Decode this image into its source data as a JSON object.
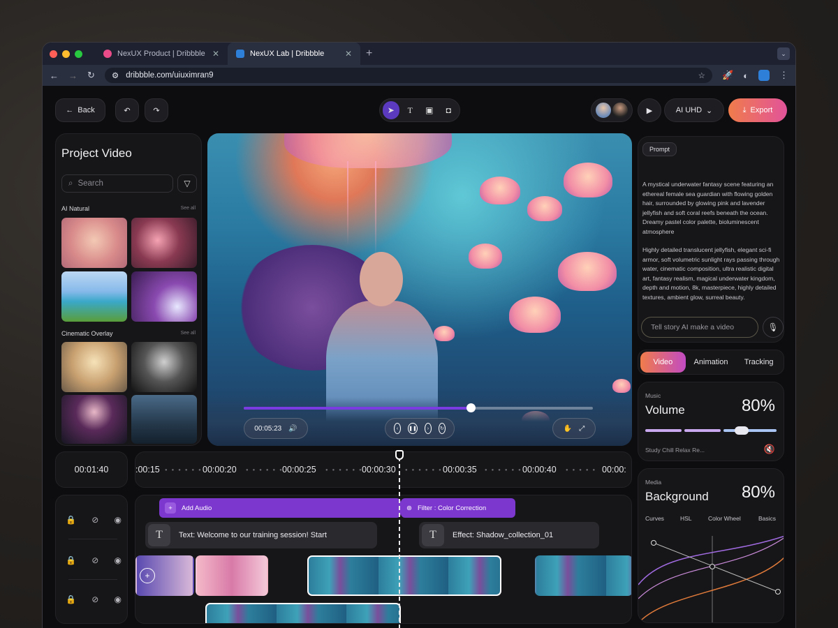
{
  "browser": {
    "tabs": [
      {
        "label": "NexUX Product  |  Dribbble",
        "active": false
      },
      {
        "label": "NexUX Lab  |  Dribbble",
        "active": true
      }
    ],
    "url": "dribbble.com/uiuximran9"
  },
  "toolbar": {
    "back_label": "Back",
    "quality_label": "AI UHD",
    "export_label": "Export"
  },
  "library": {
    "title": "Project Video",
    "search_placeholder": "Search",
    "sections": [
      {
        "title": "AI Natural",
        "see_all": "See all"
      },
      {
        "title": "Cinematic Overlay",
        "see_all": "See all"
      }
    ]
  },
  "player": {
    "current_time": "00:05:23",
    "progress": 0.65
  },
  "prompt": {
    "tag": "Prompt",
    "paragraphs": [
      "A mystical underwater fantasy scene featuring an ethereal female sea guardian with flowing golden hair, surrounded by glowing pink and lavender jellyfish and soft coral reefs beneath the ocean. Dreamy pastel color palette, bioluminescent atmosphere",
      "Highly detailed translucent jellyfish, elegant sci-fi armor, soft volumetric sunlight rays passing through water, cinematic composition, ultra realistic digital art, fantasy realism, magical underwater kingdom, depth and motion, 8k, masterpiece, highly detailed textures, ambient glow, surreal beauty."
    ],
    "input_placeholder": "Tell story AI make a video"
  },
  "mode_tabs": [
    {
      "label": "Video",
      "active": true
    },
    {
      "label": "Animation",
      "active": false
    },
    {
      "label": "Tracking",
      "active": false
    }
  ],
  "music": {
    "kicker": "Music",
    "name": "Volume",
    "value": "80%",
    "track": "Study Chill Relax Re..."
  },
  "media": {
    "kicker": "Media",
    "name": "Background",
    "value": "80%",
    "tabs": [
      "Curves",
      "HSL",
      "Color Wheel",
      "Basics"
    ]
  },
  "timeline": {
    "timecode": "00:01:40",
    "ticks": [
      ":00:15",
      "00:00:20",
      "00:00:25",
      "00:00:30",
      "00:00:35",
      "00:00:40",
      "00:00:"
    ]
  },
  "clips": {
    "audio": "Add Audio",
    "filter": "Filter : Color Correction",
    "text1": "Text: Welcome to our training session! Start",
    "text2": "Effect: Shadow_collection_01"
  },
  "colors": {
    "accent_purple": "#7c37cf",
    "accent_orange": "#f07c4b",
    "accent_pink": "#e2539a"
  }
}
